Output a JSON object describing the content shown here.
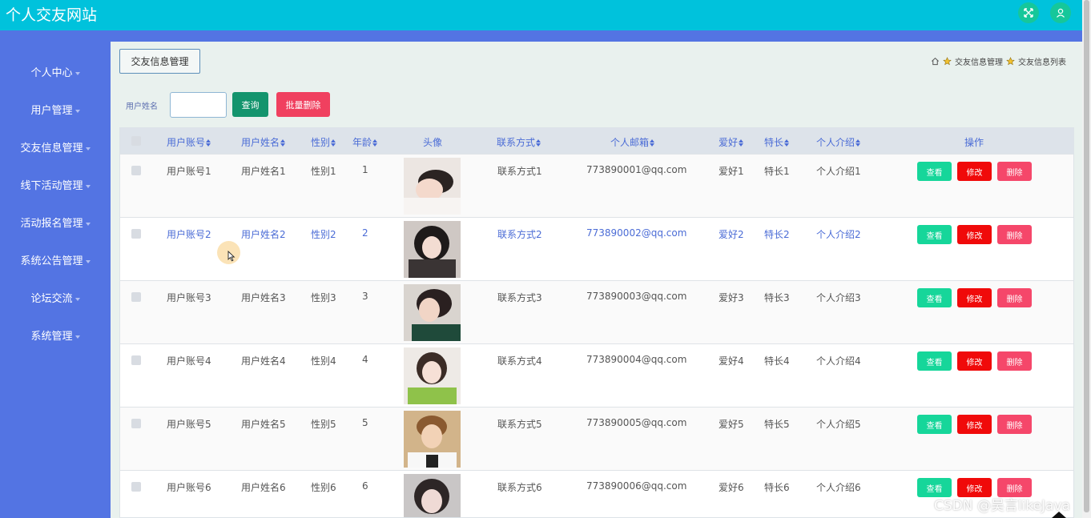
{
  "app": {
    "title": "个人交友网站"
  },
  "topbar": {
    "icons": [
      "fullscreen-icon",
      "user-icon"
    ]
  },
  "sidebar": {
    "items": [
      {
        "label": "个人中心"
      },
      {
        "label": "用户管理"
      },
      {
        "label": "交友信息管理"
      },
      {
        "label": "线下活动管理"
      },
      {
        "label": "活动报名管理"
      },
      {
        "label": "系统公告管理"
      },
      {
        "label": "论坛交流"
      },
      {
        "label": "系统管理"
      }
    ]
  },
  "page": {
    "tag": "交友信息管理",
    "breadcrumb": [
      "交友信息管理",
      "交友信息列表"
    ]
  },
  "search": {
    "label": "用户姓名",
    "value": "",
    "query_button": "查询",
    "batch_delete_button": "批量删除"
  },
  "table": {
    "headers": {
      "account": "用户账号",
      "name": "用户姓名",
      "gender": "性别",
      "age": "年龄",
      "avatar": "头像",
      "contact": "联系方式",
      "email": "个人邮箱",
      "hobby": "爱好",
      "skill": "特长",
      "intro": "个人介绍",
      "actions": "操作"
    },
    "actions": {
      "view": "查看",
      "edit": "修改",
      "delete": "删除"
    },
    "rows": [
      {
        "account": "用户账号1",
        "name": "用户姓名1",
        "gender": "性别1",
        "age": "1",
        "contact": "联系方式1",
        "email": "773890001@qq.com",
        "hobby": "爱好1",
        "skill": "特长1",
        "intro": "个人介绍1"
      },
      {
        "account": "用户账号2",
        "name": "用户姓名2",
        "gender": "性别2",
        "age": "2",
        "contact": "联系方式2",
        "email": "773890002@qq.com",
        "hobby": "爱好2",
        "skill": "特长2",
        "intro": "个人介绍2"
      },
      {
        "account": "用户账号3",
        "name": "用户姓名3",
        "gender": "性别3",
        "age": "3",
        "contact": "联系方式3",
        "email": "773890003@qq.com",
        "hobby": "爱好3",
        "skill": "特长3",
        "intro": "个人介绍3"
      },
      {
        "account": "用户账号4",
        "name": "用户姓名4",
        "gender": "性别4",
        "age": "4",
        "contact": "联系方式4",
        "email": "773890004@qq.com",
        "hobby": "爱好4",
        "skill": "特长4",
        "intro": "个人介绍4"
      },
      {
        "account": "用户账号5",
        "name": "用户姓名5",
        "gender": "性别5",
        "age": "5",
        "contact": "联系方式5",
        "email": "773890005@qq.com",
        "hobby": "爱好5",
        "skill": "特长5",
        "intro": "个人介绍5"
      },
      {
        "account": "用户账号6",
        "name": "用户姓名6",
        "gender": "性别6",
        "age": "6",
        "contact": "联系方式6",
        "email": "773890006@qq.com",
        "hobby": "爱好6",
        "skill": "特长6",
        "intro": "个人介绍6"
      }
    ]
  },
  "watermark": "CSDN @吴言likeJava",
  "colors": {
    "topbar": "#00c2dc",
    "sidebar": "#5374e3",
    "query_button": "#13946d",
    "batch_delete_button": "#f0405f",
    "view_button": "#16d69a",
    "edit_button": "#f00a0a",
    "delete_button": "#f5476a",
    "header_text": "#4b6cd6"
  }
}
